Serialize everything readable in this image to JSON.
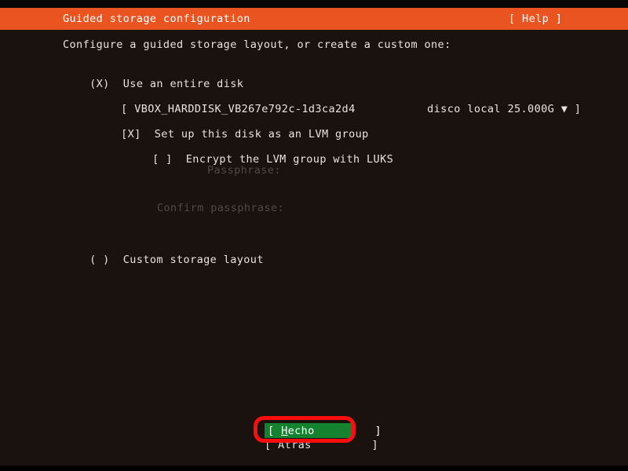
{
  "window": {
    "title": "Guided storage configuration",
    "help_label": "[ Help ]"
  },
  "main": {
    "instruction": "Configure a guided storage layout, or create a custom one:",
    "options": [
      {
        "marker": "(X)",
        "label": "Use an entire disk",
        "selected": true
      },
      {
        "marker": "( )",
        "label": "Custom storage layout",
        "selected": false
      }
    ],
    "disk_selector": {
      "open_bracket": "[",
      "device": "VBOX_HARDDISK_VB267e792c-1d3ca2d4",
      "description": "disco local 25.000G",
      "arrow": "▼",
      "close_bracket": "]"
    },
    "lvm_checkbox": {
      "marker": "[X]",
      "label": "Set up this disk as an LVM group",
      "checked": true
    },
    "luks_checkbox": {
      "marker": "[ ]",
      "label": "Encrypt the LVM group with LUKS",
      "checked": false
    },
    "passphrase_label": "Passphrase:",
    "confirm_passphrase_label": "Confirm passphrase:"
  },
  "footer": {
    "done_prefix": "[ ",
    "done_first_letter": "H",
    "done_rest": "echo",
    "done_suffix": "         ]",
    "done_label": "[ Hecho         ]",
    "back_label": "[ Atrás         ]"
  },
  "colors": {
    "header_orange": "#e95420",
    "terminal_background": "#19120f",
    "text": "#e8e4e0",
    "dim_text": "#4e4a47",
    "selected_green": "#158230",
    "annotation_red": "#fd0d0d"
  }
}
